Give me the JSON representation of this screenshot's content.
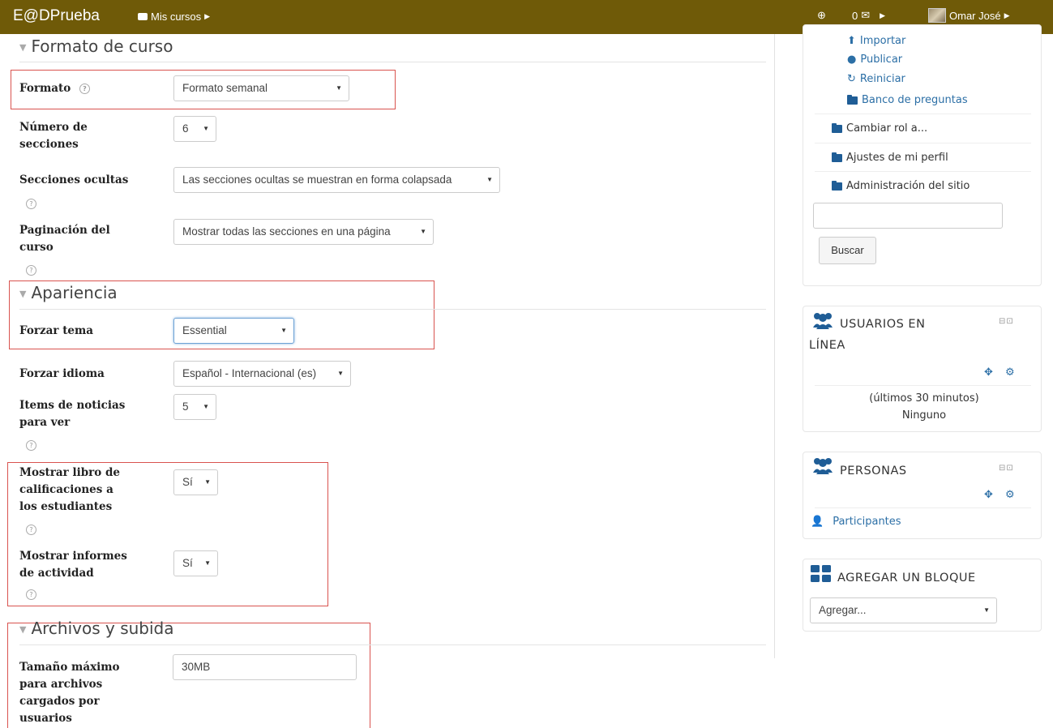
{
  "navbar": {
    "brand": "E@DPrueba",
    "my_courses": "Mis cursos",
    "messages_count": "0",
    "user_name": "Omar José"
  },
  "course_format": {
    "heading": "Formato de curso",
    "format_label": "Formato",
    "format_value": "Formato semanal",
    "sections_label_1": "Número de",
    "sections_label_2": "secciones",
    "sections_value": "6",
    "hidden_label": "Secciones ocultas",
    "hidden_value": "Las secciones ocultas se muestran en forma colapsada",
    "pagination_label_1": "Paginación del",
    "pagination_label_2": "curso",
    "pagination_value": "Mostrar todas las secciones en una página"
  },
  "appearance": {
    "heading": "Apariencia",
    "theme_label": "Forzar tema",
    "theme_value": "Essential",
    "language_label": "Forzar idioma",
    "language_value": "Español - Internacional (es)",
    "news_label_1": "Items de noticias",
    "news_label_2": "para ver",
    "news_value": "5",
    "gradebook_label_1": "Mostrar libro de",
    "gradebook_label_2": "calificaciones a",
    "gradebook_label_3": "los estudiantes",
    "gradebook_value": "Sí",
    "reports_label_1": "Mostrar informes",
    "reports_label_2": "de actividad",
    "reports_value": "Sí"
  },
  "files": {
    "heading": "Archivos y subida",
    "max_size_label_1": "Tamaño máximo",
    "max_size_label_2": "para archivos",
    "max_size_label_3": "cargados por",
    "max_size_label_4": "usuarios",
    "max_size_value": "30MB"
  },
  "admin_block": {
    "import": "Importar",
    "publish": "Publicar",
    "reset": "Reiniciar",
    "question_bank": "Banco de preguntas",
    "switch_role": "Cambiar rol a...",
    "profile_settings": "Ajustes de mi perfil",
    "site_admin": "Administración del sitio",
    "search_button": "Buscar"
  },
  "online_users_block": {
    "title_1": "USUARIOS EN",
    "title_2": "LÍNEA",
    "period": "(últimos 30 minutos)",
    "status": "Ninguno"
  },
  "people_block": {
    "title": "PERSONAS",
    "participants": "Participantes"
  },
  "add_block": {
    "title": "AGREGAR UN BLOQUE",
    "select_value": "Agregar..."
  },
  "colors": {
    "navbar": "#6f5a08",
    "link": "#2c6fa6",
    "highlight_box": "#d9534f"
  }
}
